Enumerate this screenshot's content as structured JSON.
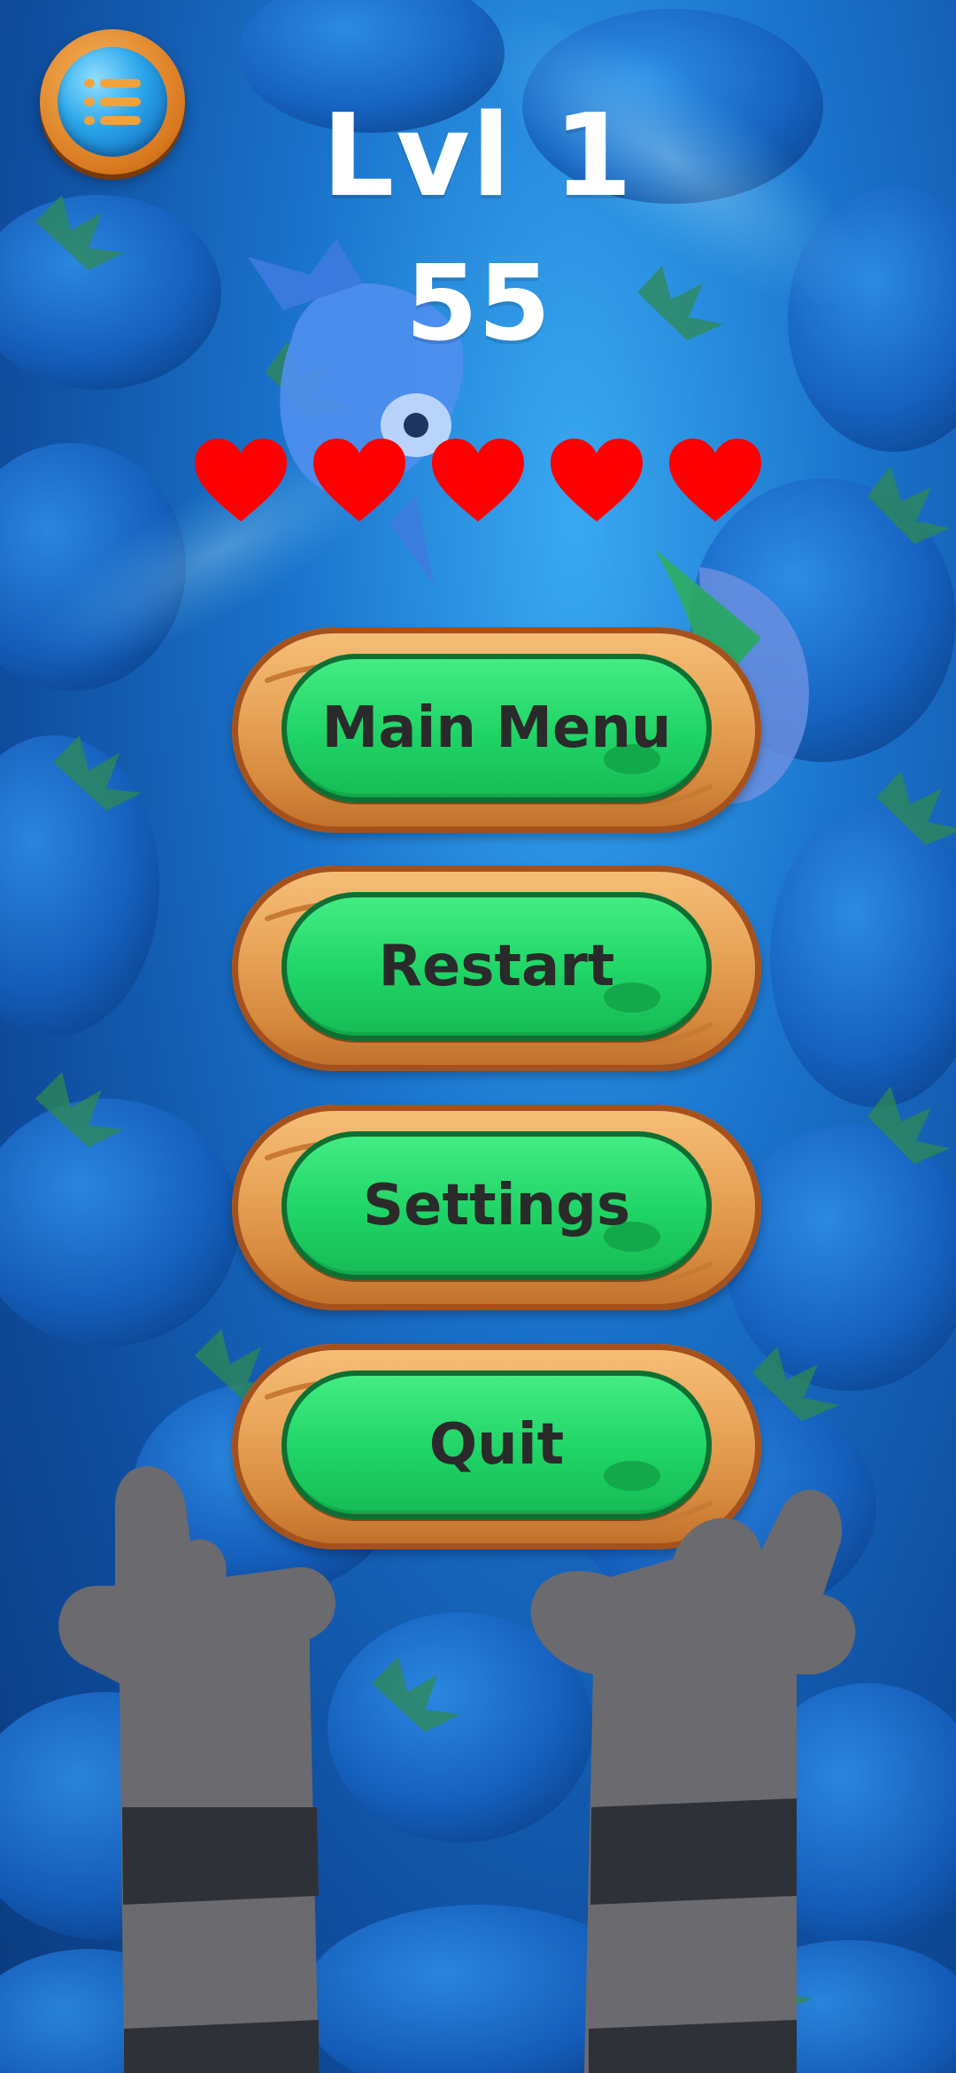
{
  "hud": {
    "menu_icon": "list-menu-icon",
    "level_label": "Lvl 1",
    "score": "55",
    "lives": 5,
    "heart_color": "#ff0000"
  },
  "menu": {
    "main_menu_label": "Main Menu",
    "restart_label": "Restart",
    "settings_label": "Settings",
    "quit_label": "Quit"
  },
  "colors": {
    "water": "#1a73cc",
    "button_green": "#1fd466",
    "wood": "#e9a55a",
    "paw_gray": "#6a6a6f",
    "paw_stripe": "#2f3138"
  }
}
